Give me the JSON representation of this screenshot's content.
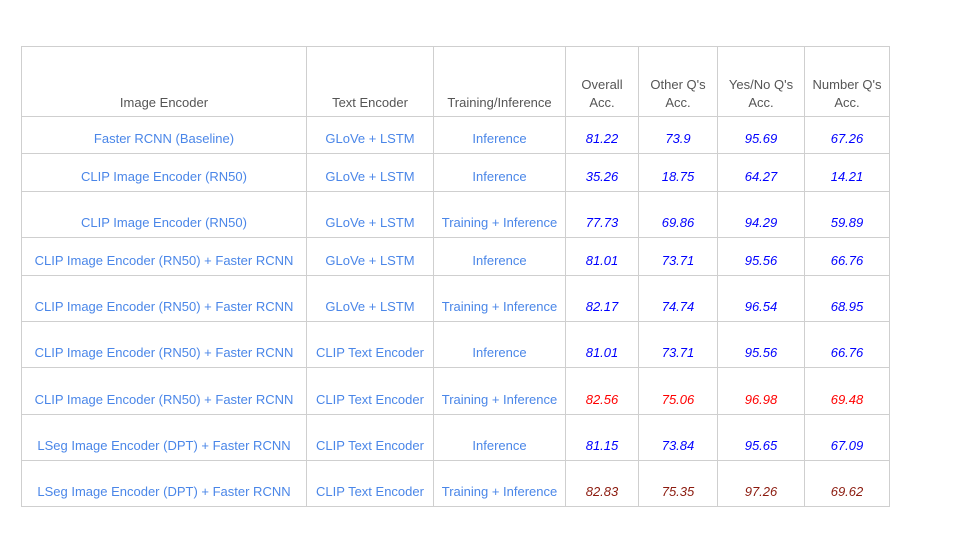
{
  "table": {
    "headers": [
      [
        "Image Encoder"
      ],
      [
        "Text Encoder"
      ],
      [
        "Training/Inference"
      ],
      [
        "Overall",
        "Acc."
      ],
      [
        "Other Q's",
        "Acc."
      ],
      [
        "Yes/No Q's",
        "Acc."
      ],
      [
        "Number Q's",
        "Acc."
      ]
    ],
    "rows": [
      {
        "image_encoder": "Faster RCNN (Baseline)",
        "text_encoder": "GLoVe + LSTM",
        "mode": "Inference",
        "overall": "81.22",
        "other": "73.9",
        "yesno": "95.69",
        "number": "67.26",
        "style": "normal"
      },
      {
        "image_encoder": "CLIP Image Encoder (RN50)",
        "text_encoder": "GLoVe + LSTM",
        "mode": "Inference",
        "overall": "35.26",
        "other": "18.75",
        "yesno": "64.27",
        "number": "14.21",
        "style": "normal"
      },
      {
        "image_encoder": "CLIP Image Encoder (RN50)",
        "text_encoder": "GLoVe + LSTM",
        "mode": "Training + Inference",
        "overall": "77.73",
        "other": "69.86",
        "yesno": "94.29",
        "number": "59.89",
        "style": "normal"
      },
      {
        "image_encoder": "CLIP Image Encoder (RN50) + Faster RCNN",
        "text_encoder": "GLoVe + LSTM",
        "mode": "Inference",
        "overall": "81.01",
        "other": "73.71",
        "yesno": "95.56",
        "number": "66.76",
        "style": "normal"
      },
      {
        "image_encoder": "CLIP Image Encoder (RN50) + Faster RCNN",
        "text_encoder": "GLoVe + LSTM",
        "mode": "Training + Inference",
        "overall": "82.17",
        "other": "74.74",
        "yesno": "96.54",
        "number": "68.95",
        "style": "normal"
      },
      {
        "image_encoder": "CLIP Image Encoder (RN50) + Faster RCNN",
        "text_encoder": "CLIP Text Encoder",
        "mode": "Inference",
        "overall": "81.01",
        "other": "73.71",
        "yesno": "95.56",
        "number": "66.76",
        "style": "normal"
      },
      {
        "image_encoder": "CLIP Image Encoder (RN50) + Faster RCNN",
        "text_encoder": "CLIP Text Encoder",
        "mode": "Training + Inference",
        "overall": "82.56",
        "other": "75.06",
        "yesno": "96.98",
        "number": "69.48",
        "style": "best"
      },
      {
        "image_encoder": "LSeg Image Encoder (DPT) + Faster RCNN",
        "text_encoder": "CLIP Text Encoder",
        "mode": "Inference",
        "overall": "81.15",
        "other": "73.84",
        "yesno": "95.65",
        "number": "67.09",
        "style": "normal"
      },
      {
        "image_encoder": "LSeg Image Encoder (DPT) + Faster RCNN",
        "text_encoder": "CLIP Text Encoder",
        "mode": "Training + Inference",
        "overall": "82.83",
        "other": "75.35",
        "yesno": "97.26",
        "number": "69.62",
        "style": "lseg-best"
      }
    ]
  },
  "colors": {
    "config_text": "#4a86e8",
    "value_text": "#0000ff",
    "best_value": "#ff0000",
    "lseg_best_value": "#8b1a0e",
    "header_text": "#555555",
    "grid": "#cfcfcf"
  }
}
